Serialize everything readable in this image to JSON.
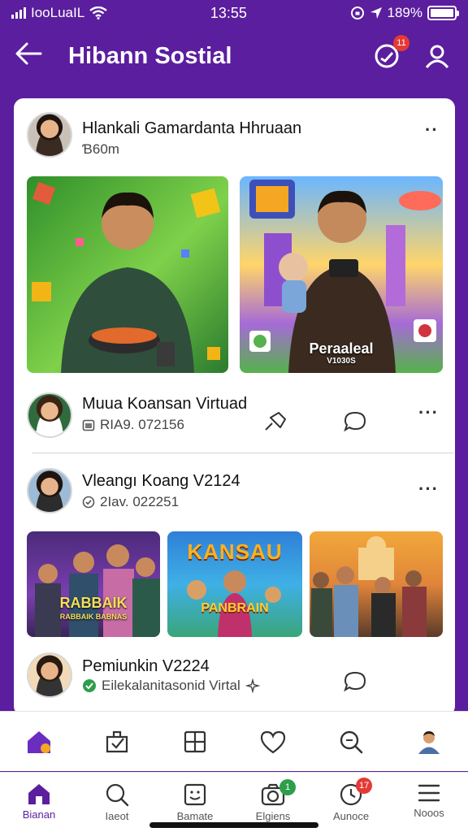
{
  "statusbar": {
    "carrier": "IooLuaIL",
    "time": "13:55",
    "battery": "189%"
  },
  "header": {
    "title": "Hibann Sostial",
    "notification_count": "11"
  },
  "post1": {
    "name": "Hlankali Gamardanta Hhruaan",
    "time": "Ɓ60m",
    "image2_caption": "Peraaleal",
    "image2_subcaption": "V1030S"
  },
  "post2": {
    "name": "Muua Koansan Virtuad",
    "meta": "RIA9. 072156"
  },
  "post3": {
    "name": "Vleangı Koang V2124",
    "meta": "2Iav. 022251",
    "img1_caption": "RABBAIK",
    "img1_subcaption": "RABBAIK BABNAS",
    "img2_title": "KANSAU",
    "img2_caption": "PANBRAIN"
  },
  "post4": {
    "name": "Pemiunkin V2224",
    "meta": "Eilekalanitasonid Virtal"
  },
  "bottomnav": {
    "items": [
      {
        "label": "Bianan"
      },
      {
        "label": "Iaeot"
      },
      {
        "label": "Bamate"
      },
      {
        "label": "Elgiens",
        "badge": "1"
      },
      {
        "label": "Aunoce",
        "badge": "17"
      },
      {
        "label": "Nooos"
      }
    ]
  },
  "colors": {
    "brand": "#5b1e9e",
    "badge": "#e53935",
    "verified_green": "#2e9e4a"
  }
}
